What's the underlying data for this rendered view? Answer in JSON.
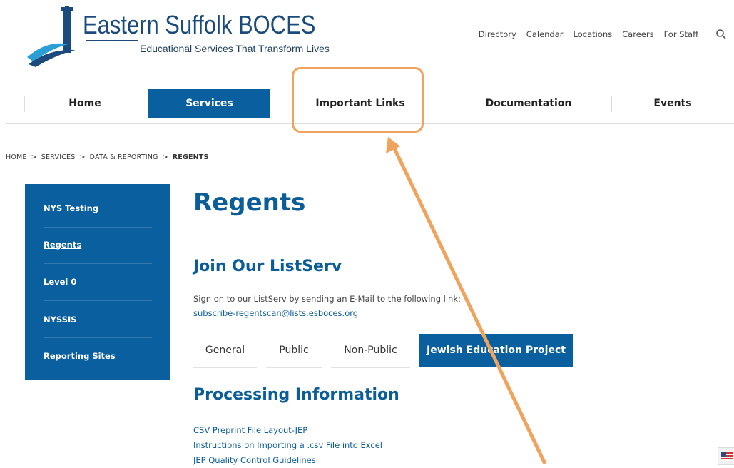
{
  "header": {
    "logo_title": "Eastern Suffolk BOCES",
    "logo_tagline": "Educational Services That Transform Lives",
    "utility_nav": [
      "Directory",
      "Calendar",
      "Locations",
      "Careers",
      "For Staff"
    ]
  },
  "main_nav": {
    "items": [
      "Home",
      "Services",
      "Important Links",
      "Documentation",
      "Events"
    ],
    "active": "Services"
  },
  "breadcrumb": {
    "items": [
      "HOME",
      "SERVICES",
      "DATA & REPORTING",
      "REGENTS"
    ],
    "separator": ">"
  },
  "sidebar": {
    "items": [
      "NYS Testing",
      "Regents",
      "Level 0",
      "NYSSIS",
      "Reporting Sites"
    ],
    "current": "Regents"
  },
  "content": {
    "title": "Regents",
    "listserv_heading": "Join Our ListServ",
    "listserv_text": "Sign on to our ListServ by sending an E-Mail to the following link:",
    "listserv_email": "subscribe-regentscan@lists.esboces.org",
    "tabs": [
      "General",
      "Public",
      "Non-Public",
      "Jewish Education Project"
    ],
    "active_tab": "Jewish Education Project",
    "processing_heading": "Processing Information",
    "links": [
      "CSV Preprint File Layout-JEP",
      "Instructions on Importing a .csv File into Excel",
      "JEP Quality Control Guidelines"
    ]
  },
  "colors": {
    "brand_blue": "#0a5f9e",
    "heading_blue": "#0b5d98",
    "annotation_orange": "#f0a35c"
  },
  "icons": [
    "search-icon",
    "lighthouse-logo-icon",
    "us-flag-icon"
  ]
}
